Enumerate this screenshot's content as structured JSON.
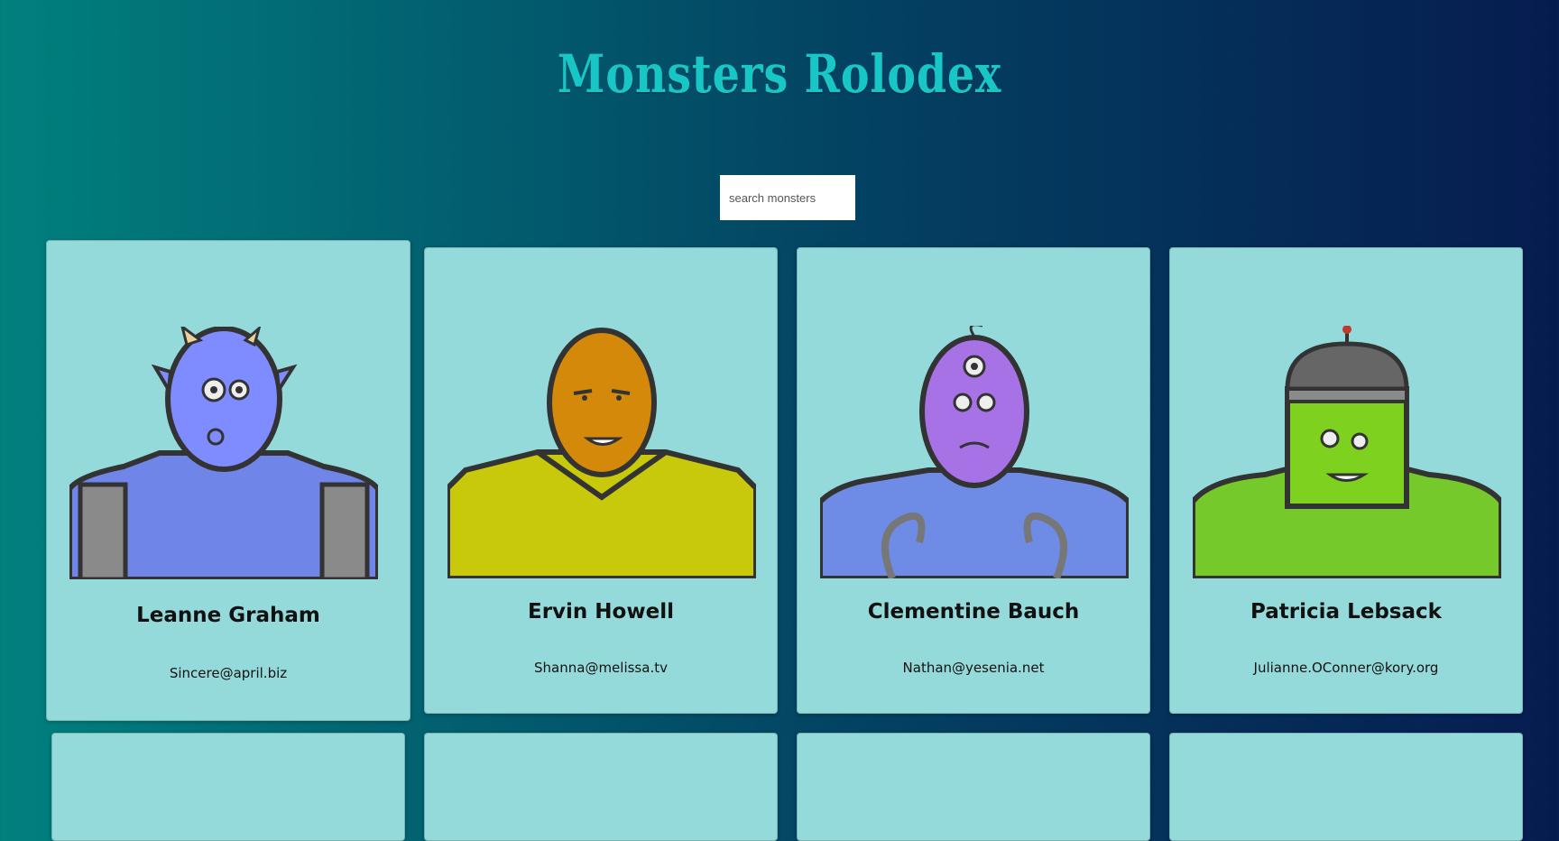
{
  "app": {
    "title": "Monsters Rolodex"
  },
  "search": {
    "placeholder": "search monsters",
    "value": ""
  },
  "monsters": [
    {
      "name": "Leanne Graham",
      "email": "Sincere@april.biz",
      "skin": "#7f8cff",
      "body": "#6f86e8"
    },
    {
      "name": "Ervin Howell",
      "email": "Shanna@melissa.tv",
      "skin": "#d4890b",
      "body": "#c9c90c"
    },
    {
      "name": "Clementine Bauch",
      "email": "Nathan@yesenia.net",
      "skin": "#a672e6",
      "body": "#6e8ce6"
    },
    {
      "name": "Patricia Lebsack",
      "email": "Julianne.OConner@kory.org",
      "skin": "#7fd11f",
      "body": "#76c92a"
    },
    {
      "name": "",
      "email": ""
    },
    {
      "name": "",
      "email": ""
    },
    {
      "name": "",
      "email": ""
    },
    {
      "name": "",
      "email": ""
    }
  ]
}
